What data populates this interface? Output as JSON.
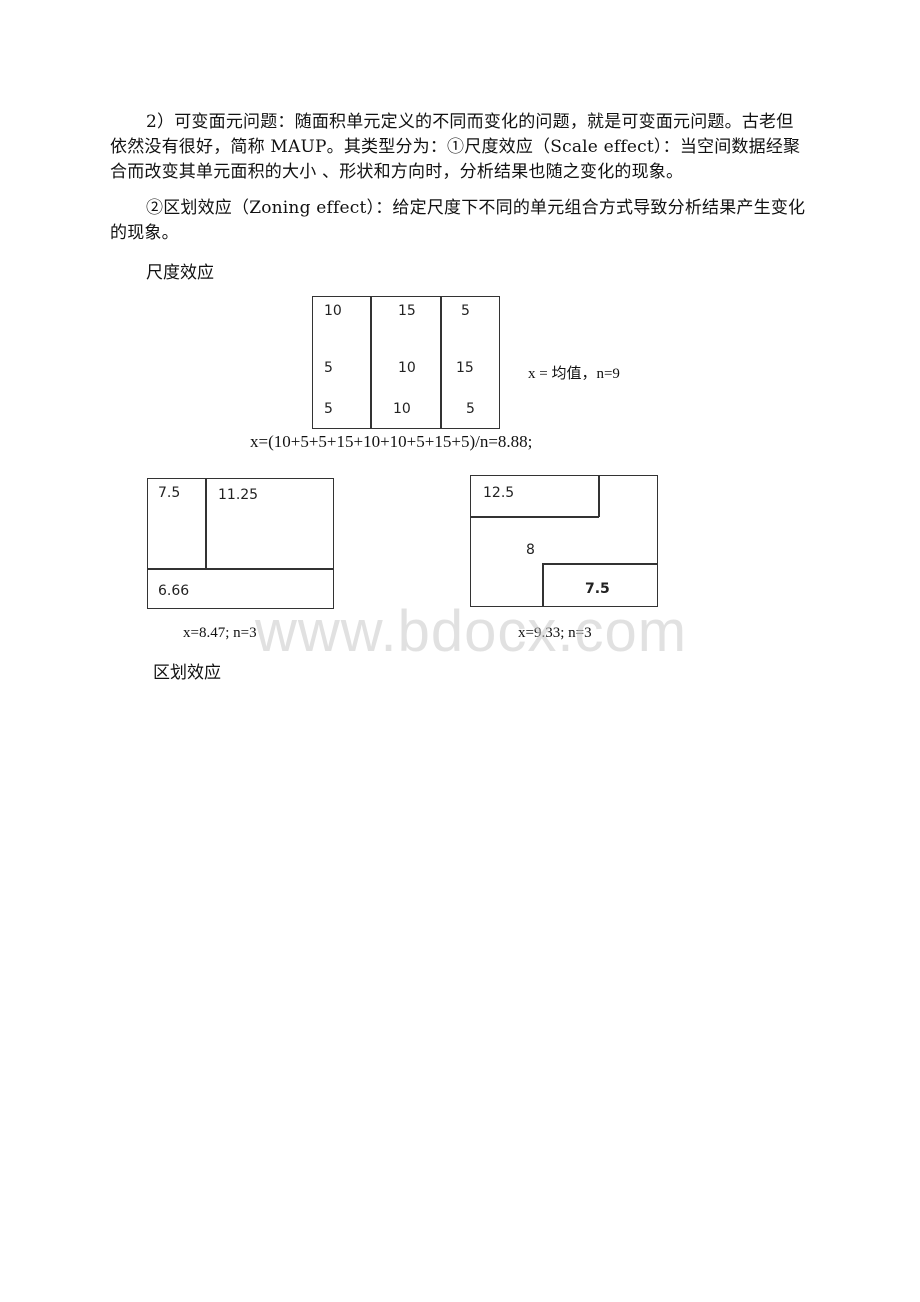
{
  "document": {
    "paragraph1": "2）可变面元问题：随面积单元定义的不同而变化的问题，就是可变面元问题。古老但依然没有很好，简称 MAUP。其类型分为：①尺度效应（Scale effect）：当空间数据经聚合而改变其单元面积的大小 、形状和方向时，分析结果也随之变化的现象。",
    "paragraph2": "②区划效应（Zoning effect）：给定尺度下不同的单元组合方式导致分析结果产生变化的现象。",
    "heading_scale": "尺度效应",
    "heading_zoning": "区划效应",
    "watermark": "www.bdocx.com"
  },
  "grid_diagram": {
    "columns": [
      [
        "10",
        "5",
        "5"
      ],
      [
        "15",
        "10",
        "10"
      ],
      [
        "5",
        "15",
        "5"
      ]
    ],
    "side_note": "x = 均值，n=9",
    "formula": "x=(10+5+5+15+10+10+5+15+5)/n=8.88;"
  },
  "zoning_left": {
    "cells": [
      "7.5",
      "11.25",
      "6.66"
    ],
    "caption": "x=8.47;  n=3"
  },
  "zoning_right": {
    "cells": [
      "12.5",
      "8",
      "7.5"
    ],
    "caption": "x=9.33; n=3"
  }
}
